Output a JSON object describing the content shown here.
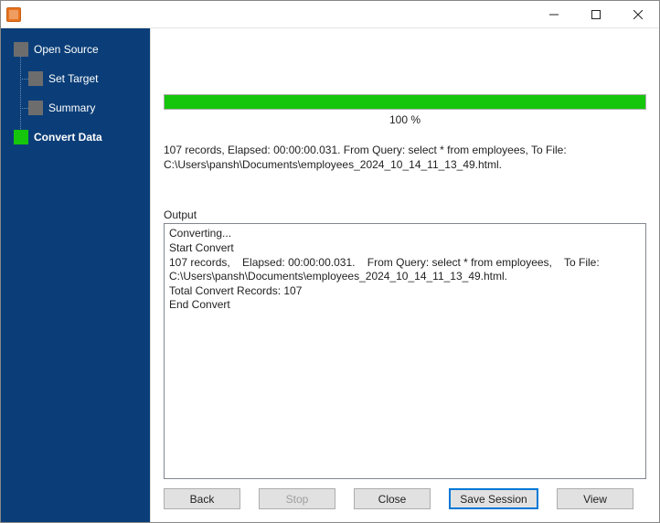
{
  "titlebar": {
    "title": ""
  },
  "sidebar": {
    "items": [
      {
        "label": "Open Source",
        "active": false,
        "level": "root"
      },
      {
        "label": "Set Target",
        "active": false,
        "level": "child"
      },
      {
        "label": "Summary",
        "active": false,
        "level": "child"
      },
      {
        "label": "Convert Data",
        "active": true,
        "level": "root",
        "current": true
      }
    ]
  },
  "progress": {
    "percent_label": "100 %"
  },
  "status": {
    "text": "107 records,    Elapsed: 00:00:00.031.    From Query: select * from employees,    To File: C:\\Users\\pansh\\Documents\\employees_2024_10_14_11_13_49.html."
  },
  "output": {
    "label": "Output",
    "lines": [
      "Converting...",
      "Start Convert",
      "107 records,    Elapsed: 00:00:00.031.    From Query: select * from employees,    To File: C:\\Users\\pansh\\Documents\\employees_2024_10_14_11_13_49.html.",
      "Total Convert Records: 107",
      "End Convert"
    ]
  },
  "buttons": {
    "back": "Back",
    "stop": "Stop",
    "close": "Close",
    "save_session": "Save Session",
    "view": "View"
  }
}
